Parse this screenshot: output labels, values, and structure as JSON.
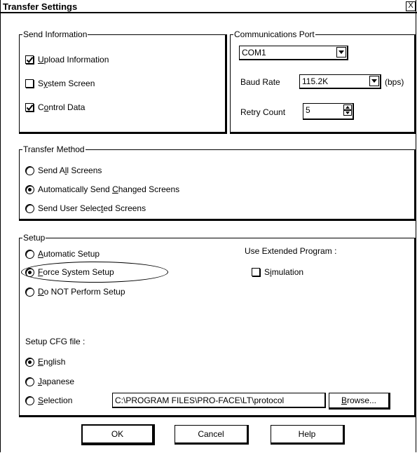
{
  "window": {
    "title": "Transfer Settings",
    "close_glyph": "X"
  },
  "send_information": {
    "legend": "Send Information",
    "upload_information": {
      "label_mnemonic": "U",
      "label_rest": "pload Information",
      "checked": true
    },
    "system_screen": {
      "label_pre": "S",
      "label_mnemonic": "y",
      "label_rest": "stem Screen",
      "checked": false
    },
    "control_data": {
      "label_pre": "C",
      "label_mnemonic": "o",
      "label_rest": "ntrol Data",
      "checked": true
    }
  },
  "communications_port": {
    "legend": "Communications Port",
    "port_value": "COM1",
    "baud_rate_label": "Baud Rate",
    "baud_rate_value": "115.2K",
    "baud_unit": "(bps)",
    "retry_count_label": "Retry Count",
    "retry_count_value": "5"
  },
  "transfer_method": {
    "legend": "Transfer Method",
    "options": [
      {
        "pre": "Send A",
        "mn": "l",
        "post": "l Screens",
        "selected": false
      },
      {
        "pre": "Automatically Send ",
        "mn": "C",
        "post": "hanged Screens",
        "selected": true
      },
      {
        "pre": "Send User Selec",
        "mn": "t",
        "post": "ed Screens",
        "selected": false
      }
    ]
  },
  "setup": {
    "legend": "Setup",
    "options": [
      {
        "pre": "",
        "mn": "A",
        "post": "utomatic Setup",
        "selected": false
      },
      {
        "pre": "",
        "mn": "F",
        "post": "orce System Setup",
        "selected": true
      },
      {
        "pre": "",
        "mn": "D",
        "post": "o NOT Perform Setup",
        "selected": false
      }
    ],
    "extended_program_label": "Use Extended Program :",
    "simulation": {
      "pre": "S",
      "mn": "i",
      "post": "mulation",
      "checked": false
    },
    "cfg_label": "Setup CFG file :",
    "cfg_options": [
      {
        "pre": "",
        "mn": "E",
        "post": "nglish",
        "selected": true
      },
      {
        "pre": "",
        "mn": "J",
        "post": "apanese",
        "selected": false
      },
      {
        "pre": "",
        "mn": "S",
        "post": "election",
        "selected": false
      }
    ],
    "path_value": "C:\\PROGRAM FILES\\PRO-FACE\\LT\\protocol",
    "browse_mn": "B",
    "browse_rest": "rowse..."
  },
  "buttons": {
    "ok": "OK",
    "cancel": "Cancel",
    "help": "Help"
  }
}
